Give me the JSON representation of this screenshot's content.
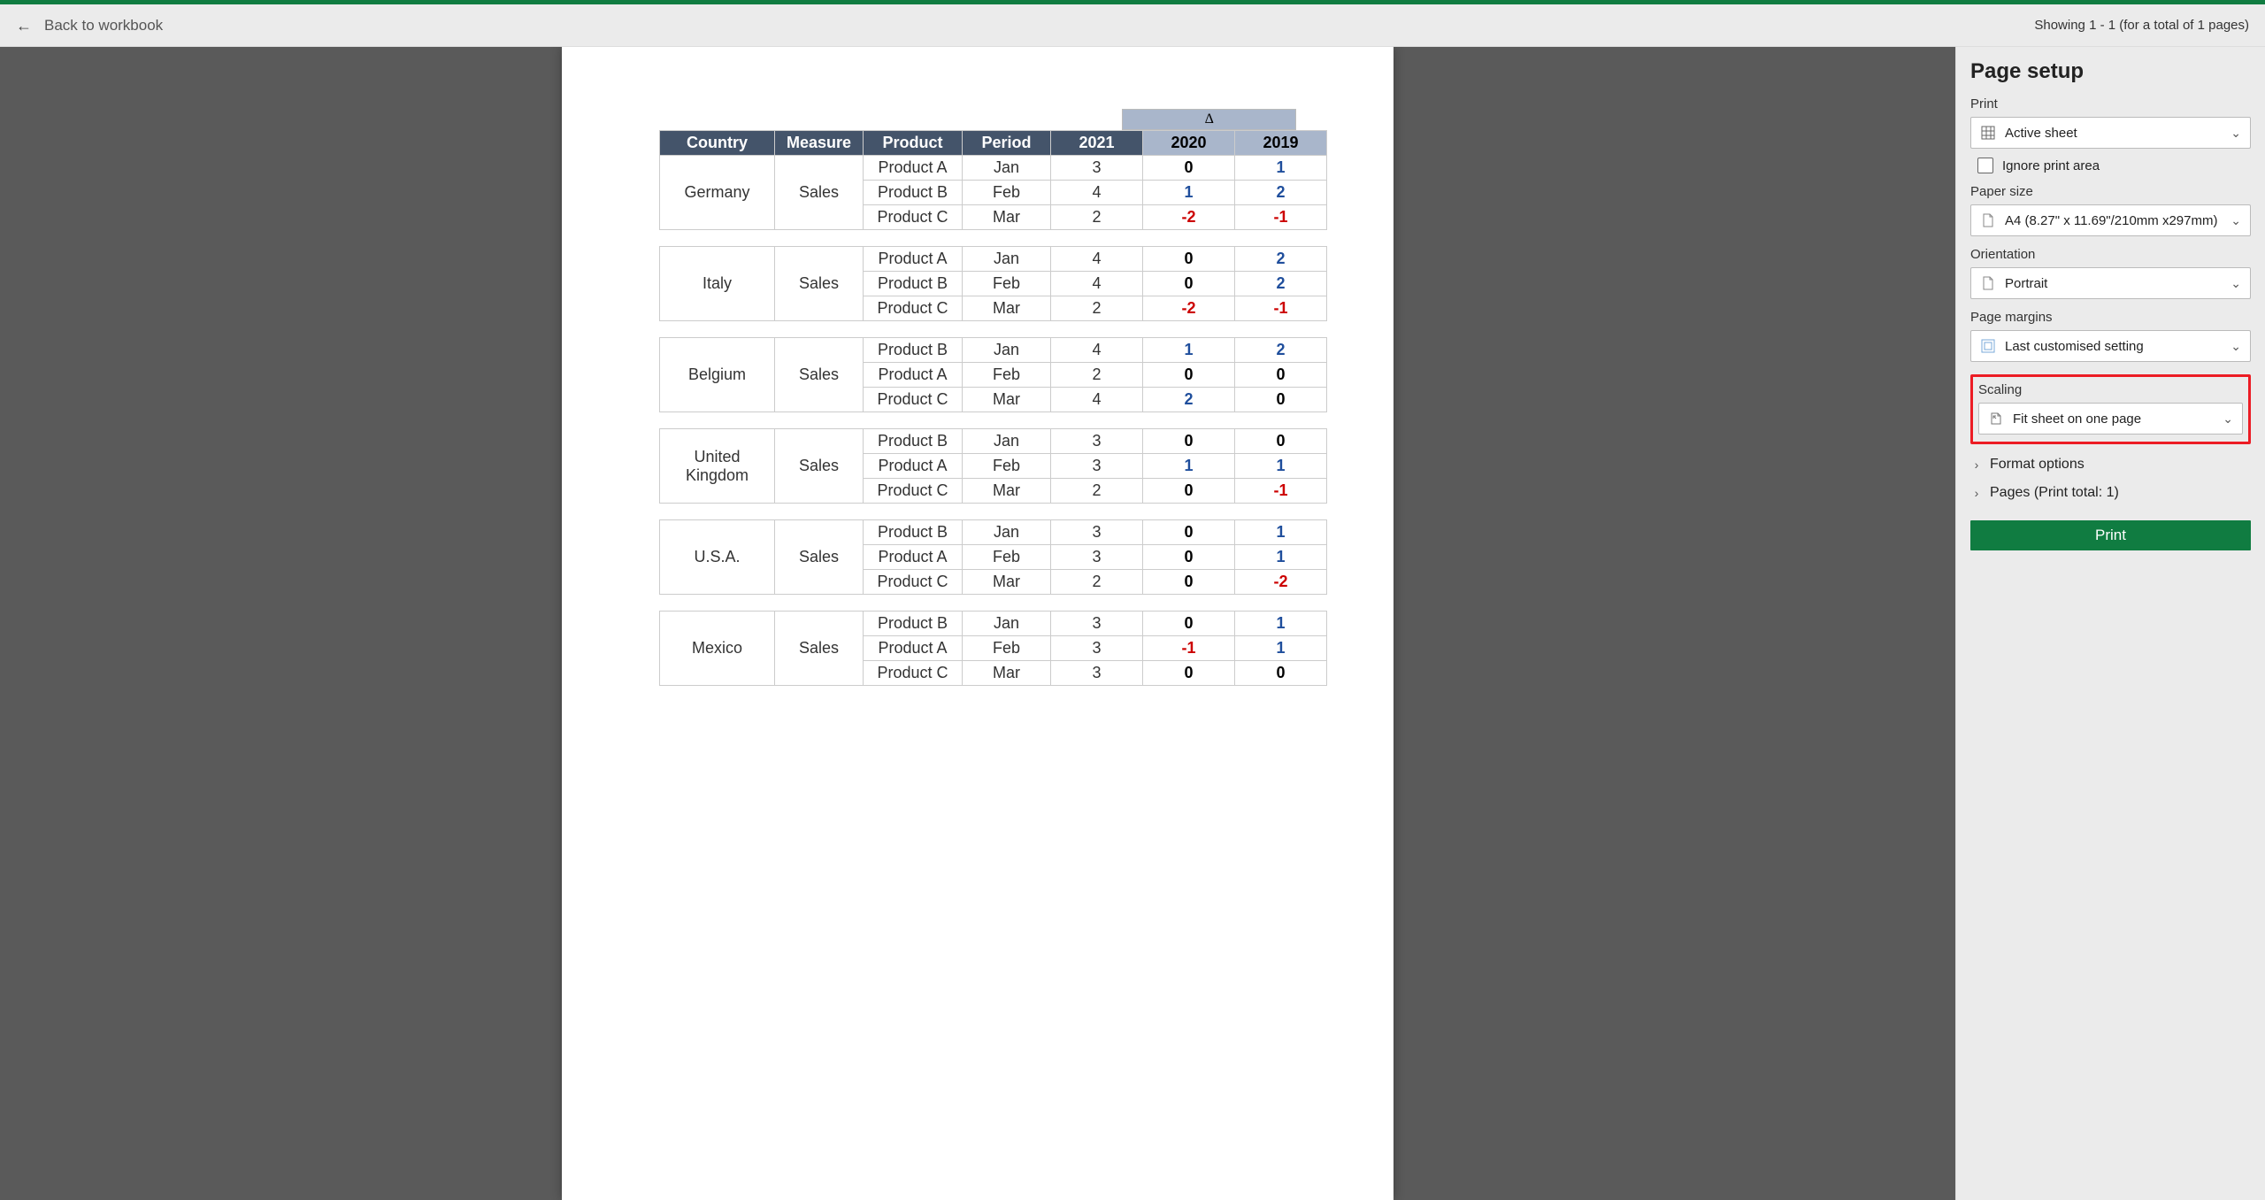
{
  "brandColor": "#107c41",
  "topBar": {
    "backLabel": "Back to workbook",
    "showing": "Showing 1 - 1 (for a total of 1 pages)"
  },
  "deltaSymbol": "Δ",
  "headers": [
    "Country",
    "Measure",
    "Product",
    "Period",
    "2021",
    "2020",
    "2019"
  ],
  "blocks": [
    {
      "country": "Germany",
      "measure": "Sales",
      "rows": [
        {
          "product": "Product A",
          "period": "Jan",
          "y2021": "3",
          "y2020": {
            "v": "0",
            "cls": "black-bold"
          },
          "y2019": {
            "v": "1",
            "cls": "blue-bold"
          }
        },
        {
          "product": "Product B",
          "period": "Feb",
          "y2021": "4",
          "y2020": {
            "v": "1",
            "cls": "blue-bold"
          },
          "y2019": {
            "v": "2",
            "cls": "blue-bold"
          }
        },
        {
          "product": "Product C",
          "period": "Mar",
          "y2021": "2",
          "y2020": {
            "v": "-2",
            "cls": "red-bold"
          },
          "y2019": {
            "v": "-1",
            "cls": "red-bold"
          }
        }
      ]
    },
    {
      "country": "Italy",
      "measure": "Sales",
      "rows": [
        {
          "product": "Product A",
          "period": "Jan",
          "y2021": "4",
          "y2020": {
            "v": "0",
            "cls": "black-bold"
          },
          "y2019": {
            "v": "2",
            "cls": "blue-bold"
          }
        },
        {
          "product": "Product B",
          "period": "Feb",
          "y2021": "4",
          "y2020": {
            "v": "0",
            "cls": "black-bold"
          },
          "y2019": {
            "v": "2",
            "cls": "blue-bold"
          }
        },
        {
          "product": "Product C",
          "period": "Mar",
          "y2021": "2",
          "y2020": {
            "v": "-2",
            "cls": "red-bold"
          },
          "y2019": {
            "v": "-1",
            "cls": "red-bold"
          }
        }
      ]
    },
    {
      "country": "Belgium",
      "measure": "Sales",
      "rows": [
        {
          "product": "Product B",
          "period": "Jan",
          "y2021": "4",
          "y2020": {
            "v": "1",
            "cls": "blue-bold"
          },
          "y2019": {
            "v": "2",
            "cls": "blue-bold"
          }
        },
        {
          "product": "Product A",
          "period": "Feb",
          "y2021": "2",
          "y2020": {
            "v": "0",
            "cls": "black-bold"
          },
          "y2019": {
            "v": "0",
            "cls": "black-bold"
          }
        },
        {
          "product": "Product C",
          "period": "Mar",
          "y2021": "4",
          "y2020": {
            "v": "2",
            "cls": "blue-bold"
          },
          "y2019": {
            "v": "0",
            "cls": "black-bold"
          }
        }
      ]
    },
    {
      "country": "United Kingdom",
      "measure": "Sales",
      "rows": [
        {
          "product": "Product B",
          "period": "Jan",
          "y2021": "3",
          "y2020": {
            "v": "0",
            "cls": "black-bold"
          },
          "y2019": {
            "v": "0",
            "cls": "black-bold"
          }
        },
        {
          "product": "Product A",
          "period": "Feb",
          "y2021": "3",
          "y2020": {
            "v": "1",
            "cls": "blue-bold"
          },
          "y2019": {
            "v": "1",
            "cls": "blue-bold"
          }
        },
        {
          "product": "Product C",
          "period": "Mar",
          "y2021": "2",
          "y2020": {
            "v": "0",
            "cls": "black-bold"
          },
          "y2019": {
            "v": "-1",
            "cls": "red-bold"
          }
        }
      ]
    },
    {
      "country": "U.S.A.",
      "measure": "Sales",
      "rows": [
        {
          "product": "Product B",
          "period": "Jan",
          "y2021": "3",
          "y2020": {
            "v": "0",
            "cls": "black-bold"
          },
          "y2019": {
            "v": "1",
            "cls": "blue-bold"
          }
        },
        {
          "product": "Product A",
          "period": "Feb",
          "y2021": "3",
          "y2020": {
            "v": "0",
            "cls": "black-bold"
          },
          "y2019": {
            "v": "1",
            "cls": "blue-bold"
          }
        },
        {
          "product": "Product C",
          "period": "Mar",
          "y2021": "2",
          "y2020": {
            "v": "0",
            "cls": "black-bold"
          },
          "y2019": {
            "v": "-2",
            "cls": "red-bold"
          }
        }
      ]
    },
    {
      "country": "Mexico",
      "measure": "Sales",
      "rows": [
        {
          "product": "Product B",
          "period": "Jan",
          "y2021": "3",
          "y2020": {
            "v": "0",
            "cls": "black-bold"
          },
          "y2019": {
            "v": "1",
            "cls": "blue-bold"
          }
        },
        {
          "product": "Product A",
          "period": "Feb",
          "y2021": "3",
          "y2020": {
            "v": "-1",
            "cls": "red-bold"
          },
          "y2019": {
            "v": "1",
            "cls": "blue-bold"
          }
        },
        {
          "product": "Product C",
          "period": "Mar",
          "y2021": "3",
          "y2020": {
            "v": "0",
            "cls": "black-bold"
          },
          "y2019": {
            "v": "0",
            "cls": "black-bold"
          }
        }
      ]
    }
  ],
  "sidebar": {
    "title": "Page setup",
    "print": {
      "label": "Print",
      "value": "Active sheet",
      "ignore": "Ignore print area"
    },
    "paper": {
      "label": "Paper size",
      "value": "A4 (8.27\" x 11.69\"/210mm x297mm)"
    },
    "orientation": {
      "label": "Orientation",
      "value": "Portrait"
    },
    "margins": {
      "label": "Page margins",
      "value": "Last customised setting"
    },
    "scaling": {
      "label": "Scaling",
      "value": "Fit sheet on one page"
    },
    "format": "Format options",
    "pages": "Pages (Print total: 1)",
    "printBtn": "Print"
  }
}
